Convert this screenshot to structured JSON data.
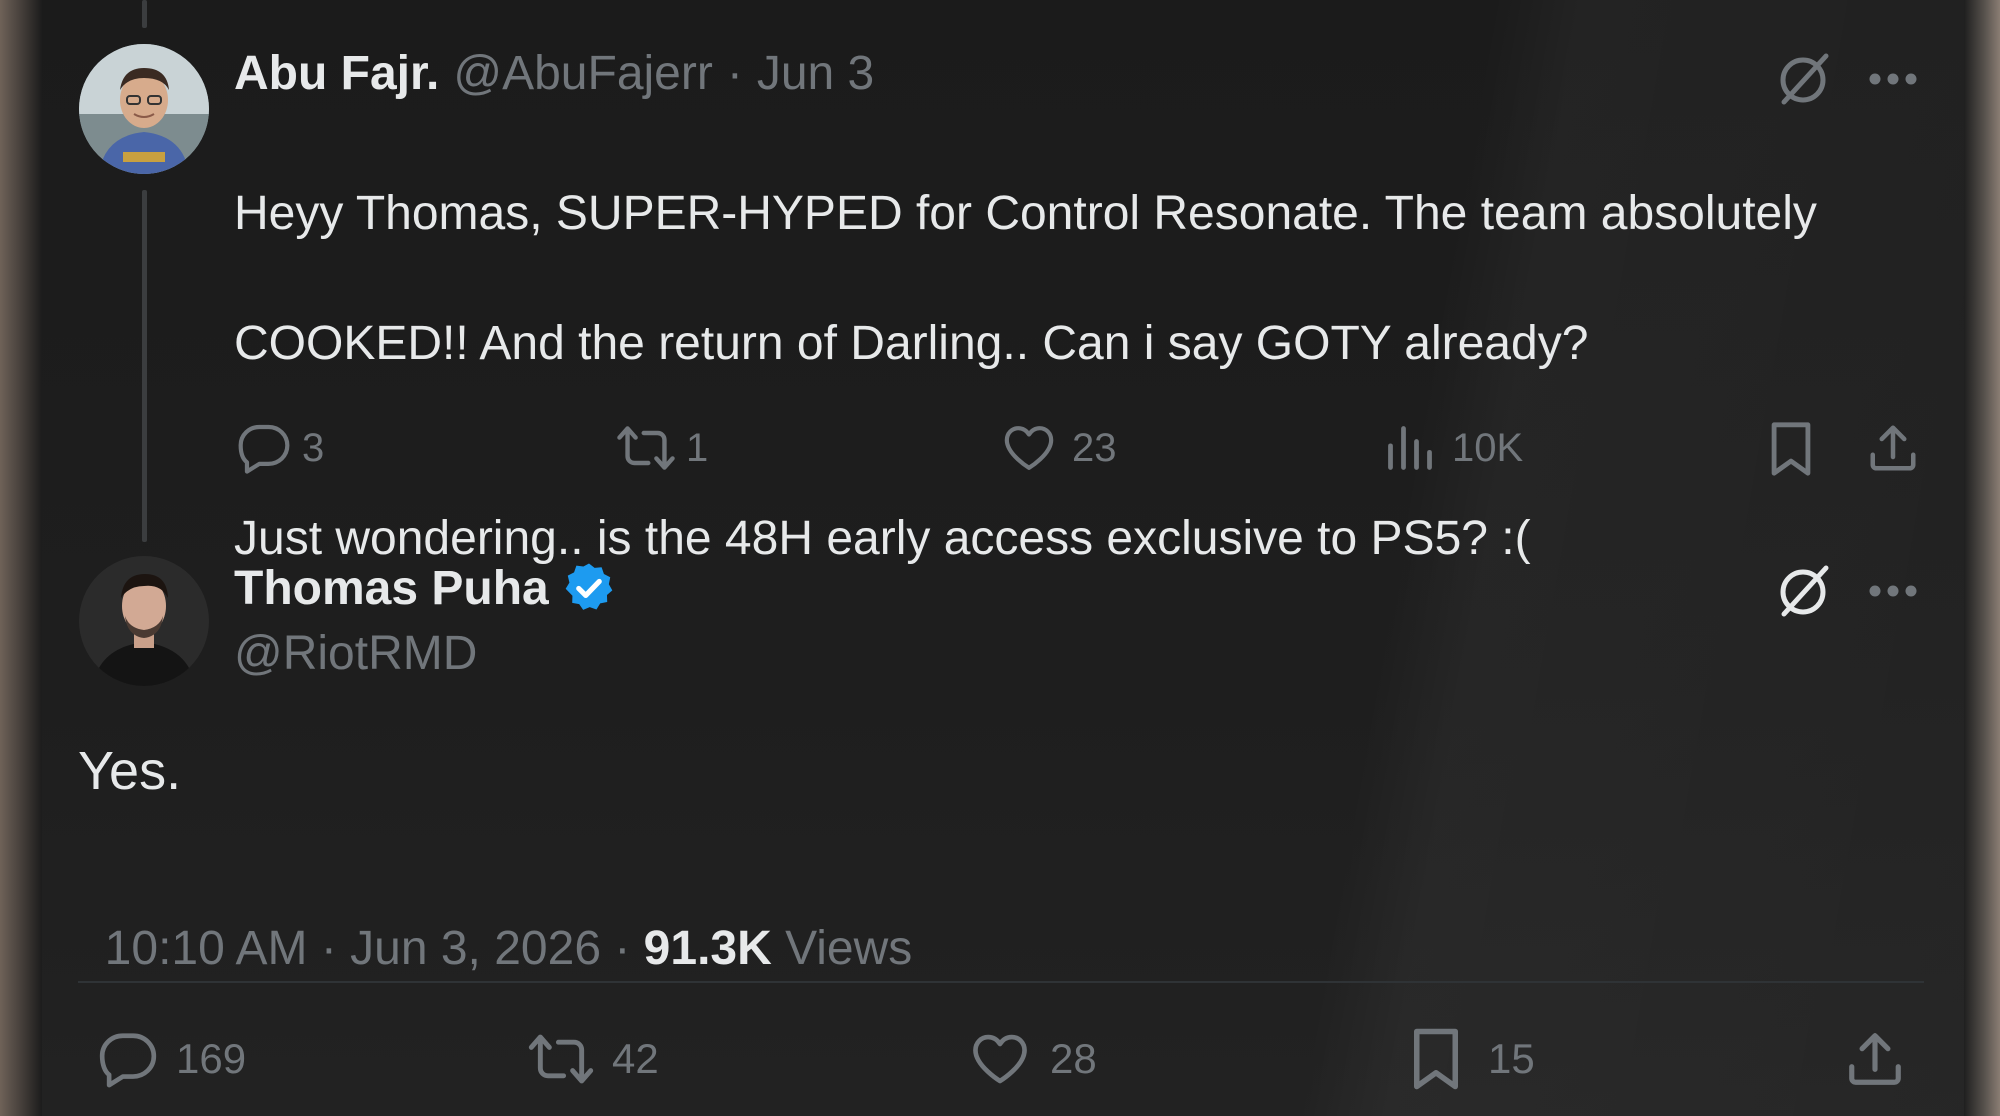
{
  "parent_tweet": {
    "author_name": "Abu Fajr.",
    "handle": "@AbuFajerr",
    "separator": "·",
    "date": "Jun 3",
    "text_line1": "Heyy Thomas, SUPER-HYPED for Control Resonate. The team absolutely",
    "text_line2": "COOKED!! And the return of Darling.. Can i say GOTY already?",
    "text_line3": "Just wondering.. is the 48H early access exclusive to PS5? :(",
    "actions": {
      "replies": "3",
      "reposts": "1",
      "likes": "23",
      "views": "10K"
    }
  },
  "main_tweet": {
    "author_name": "Thomas Puha",
    "verified": true,
    "handle": "@RiotRMD",
    "text": "Yes.",
    "timestamp": "10:10 AM · Jun 3, 2026 · ",
    "views_count": "91.3K",
    "views_label": " Views",
    "actions": {
      "replies": "169",
      "reposts": "42",
      "likes": "28",
      "bookmarks": "15"
    }
  },
  "colors": {
    "background": "#1e1e1e",
    "text_primary": "#e7e9ea",
    "text_muted": "#71767b",
    "verified_blue": "#1d9bf0"
  },
  "icons": [
    "grok-icon",
    "more-icon",
    "reply-icon",
    "repost-icon",
    "like-icon",
    "views-icon",
    "bookmark-icon",
    "share-icon",
    "verified-badge-icon"
  ]
}
